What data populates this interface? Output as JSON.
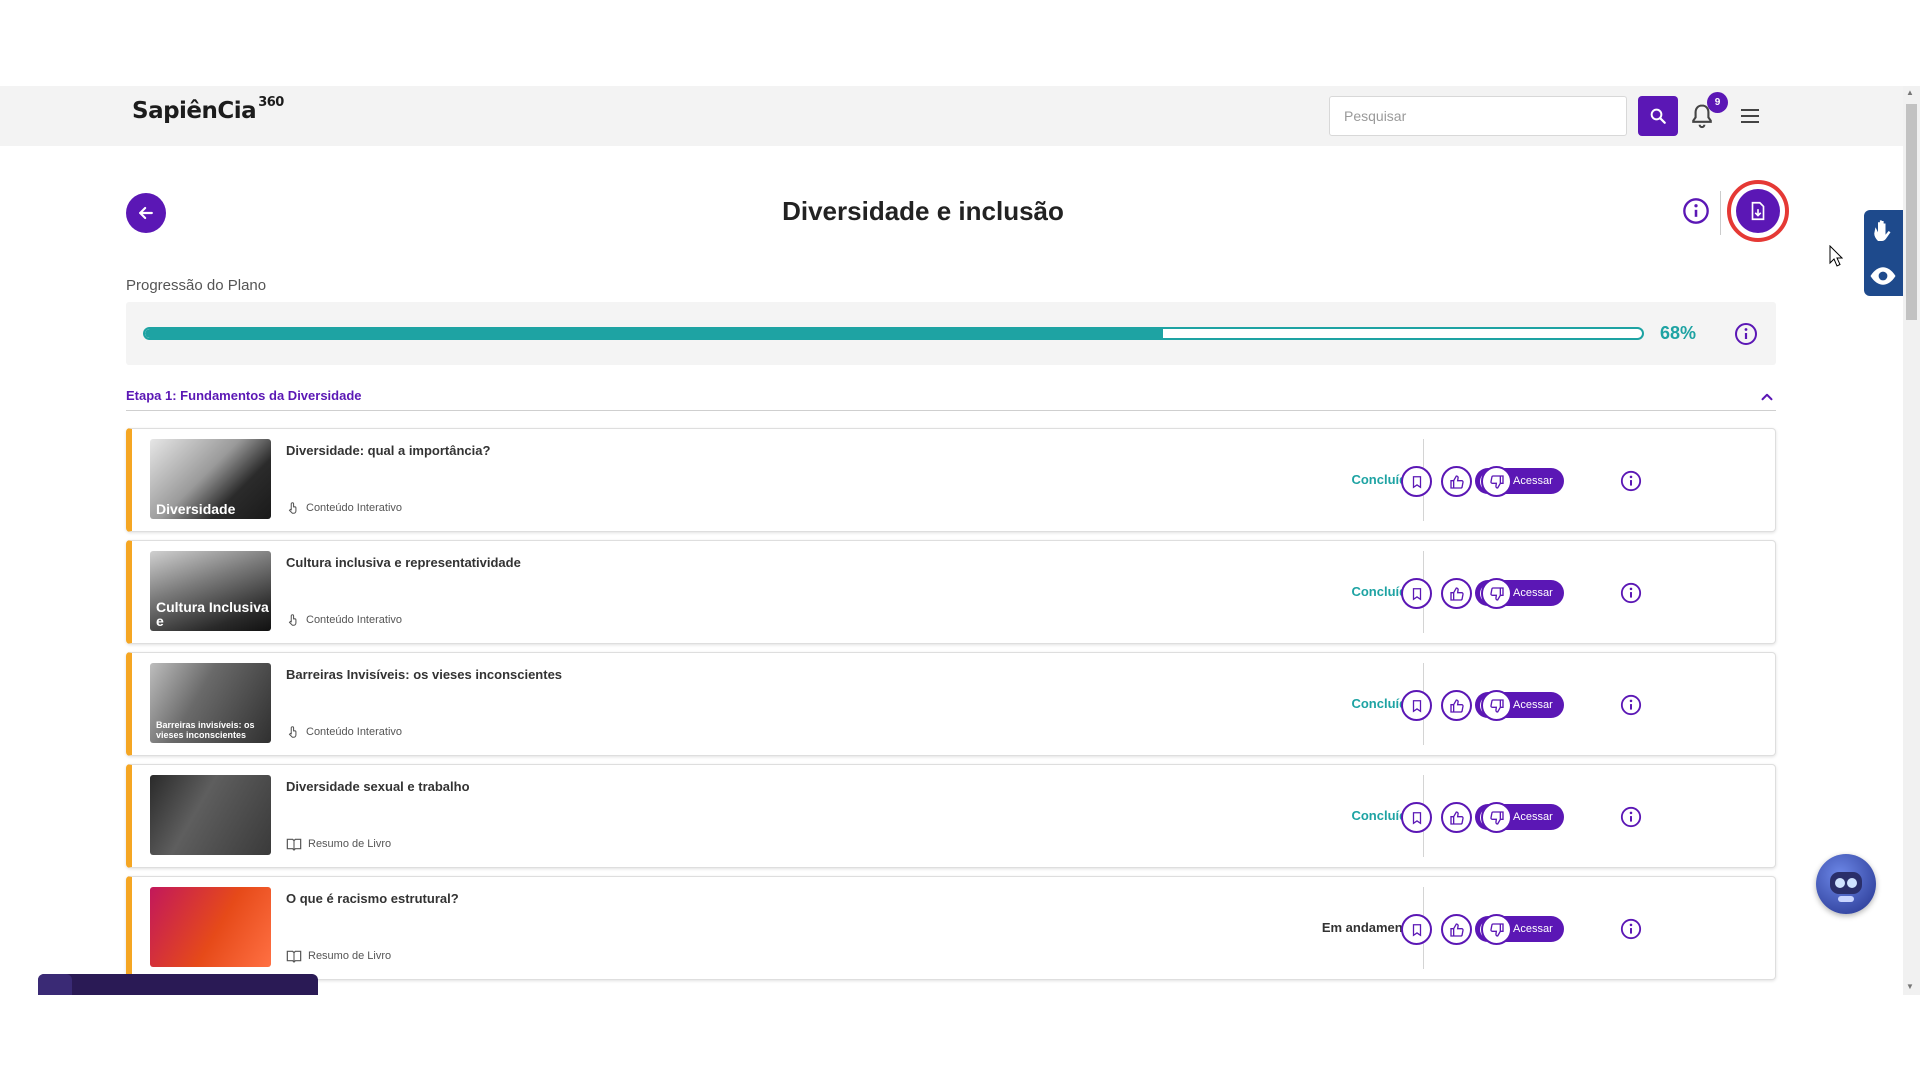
{
  "header": {
    "logo_main": "SapiênCia",
    "logo_suffix": "360",
    "search_placeholder": "Pesquisar",
    "notification_count": "9"
  },
  "page": {
    "title": "Diversidade e inclusão"
  },
  "progress": {
    "label": "Progressão do Plano",
    "percent_text": "68%",
    "percent_value": 68
  },
  "stage": {
    "title": "Etapa 1: Fundamentos da Diversidade"
  },
  "items": [
    {
      "title": "Diversidade: qual a importância?",
      "type": "Conteúdo Interativo",
      "type_icon": "touch-icon",
      "status": "Concluído",
      "thumb_text": "Diversidade",
      "access_label": "Acessar"
    },
    {
      "title": "Cultura inclusiva e representatividade",
      "type": "Conteúdo Interativo",
      "type_icon": "touch-icon",
      "status": "Concluído",
      "thumb_text": "Cultura Inclusiva e",
      "access_label": "Acessar"
    },
    {
      "title": "Barreiras Invisíveis: os vieses inconscientes",
      "type": "Conteúdo Interativo",
      "type_icon": "touch-icon",
      "status": "Concluído",
      "thumb_text": "Barreiras invisíveis: os vieses inconscientes",
      "access_label": "Acessar"
    },
    {
      "title": "Diversidade sexual e trabalho",
      "type": "Resumo de Livro",
      "type_icon": "book-icon",
      "status": "Concluído",
      "thumb_text": "",
      "access_label": "Acessar"
    },
    {
      "title": "O que é racismo estrutural?",
      "type": "Resumo de Livro",
      "type_icon": "book-icon",
      "status": "Em andamento",
      "thumb_text": "",
      "access_label": "Acessar"
    }
  ],
  "colors": {
    "primary": "#5b17b5",
    "teal": "#1ea3a3",
    "accent_orange": "#f5a623",
    "highlight_red": "#e53935"
  }
}
